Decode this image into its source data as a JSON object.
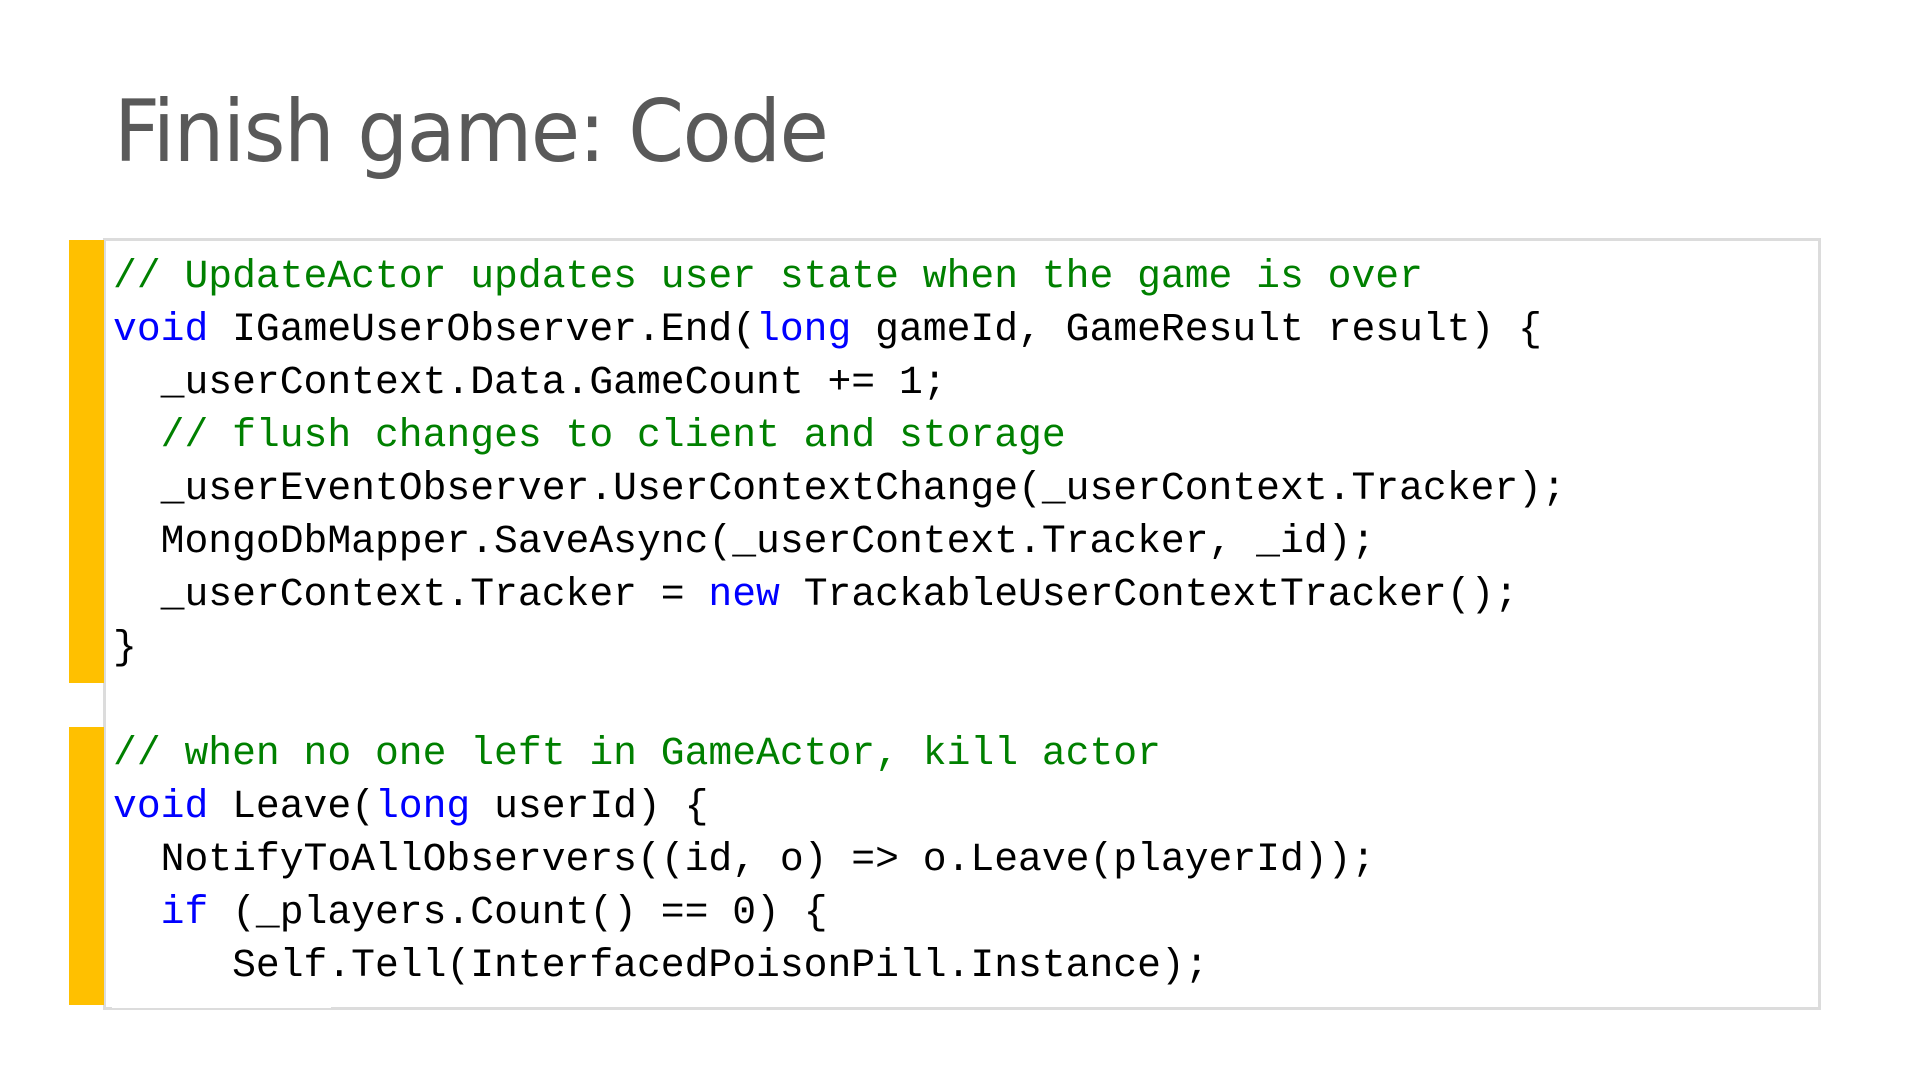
{
  "slide": {
    "title": "Finish game: Code",
    "colors": {
      "accent": "#FFC000",
      "title": "#595959",
      "comment": "#008000",
      "keyword": "#0000FF",
      "text": "#000000",
      "box_border": "#DCDCDC"
    },
    "code_blocks": [
      {
        "name": "update-actor-end",
        "lines": [
          [
            {
              "t": "comment",
              "v": "// UpdateActor updates user state when the game is over"
            }
          ],
          [
            {
              "t": "keyword",
              "v": "void"
            },
            {
              "t": "plain",
              "v": " IGameUserObserver.End("
            },
            {
              "t": "keyword",
              "v": "long"
            },
            {
              "t": "plain",
              "v": " gameId, GameResult result) {"
            }
          ],
          [
            {
              "t": "plain",
              "v": "  _userContext.Data.GameCount += 1;"
            }
          ],
          [
            {
              "t": "plain",
              "v": "  "
            },
            {
              "t": "comment",
              "v": "// flush changes to client and storage"
            }
          ],
          [
            {
              "t": "plain",
              "v": "  _userEventObserver.UserContextChange(_userContext.Tracker);"
            }
          ],
          [
            {
              "t": "plain",
              "v": "  MongoDbMapper.SaveAsync(_userContext.Tracker, _id);"
            }
          ],
          [
            {
              "t": "plain",
              "v": "  _userContext.Tracker = "
            },
            {
              "t": "keyword",
              "v": "new"
            },
            {
              "t": "plain",
              "v": " TrackableUserContextTracker();"
            }
          ],
          [
            {
              "t": "plain",
              "v": "}"
            }
          ]
        ]
      },
      {
        "name": "game-actor-leave",
        "lines": [
          [
            {
              "t": "plain",
              "v": ""
            }
          ],
          [
            {
              "t": "comment",
              "v": "// when no one left in GameActor, kill actor"
            }
          ],
          [
            {
              "t": "keyword",
              "v": "void"
            },
            {
              "t": "plain",
              "v": " Leave("
            },
            {
              "t": "keyword",
              "v": "long"
            },
            {
              "t": "plain",
              "v": " userId) {"
            }
          ],
          [
            {
              "t": "plain",
              "v": "  NotifyToAllObservers((id, o) => o.Leave(playerId));"
            }
          ],
          [
            {
              "t": "plain",
              "v": "  "
            },
            {
              "t": "keyword",
              "v": "if"
            },
            {
              "t": "plain",
              "v": " (_players.Count() == 0) {"
            }
          ],
          [
            {
              "t": "plain",
              "v": "     Self.Tell(InterfacedPoisonPill.Instance);"
            }
          ]
        ]
      }
    ]
  }
}
